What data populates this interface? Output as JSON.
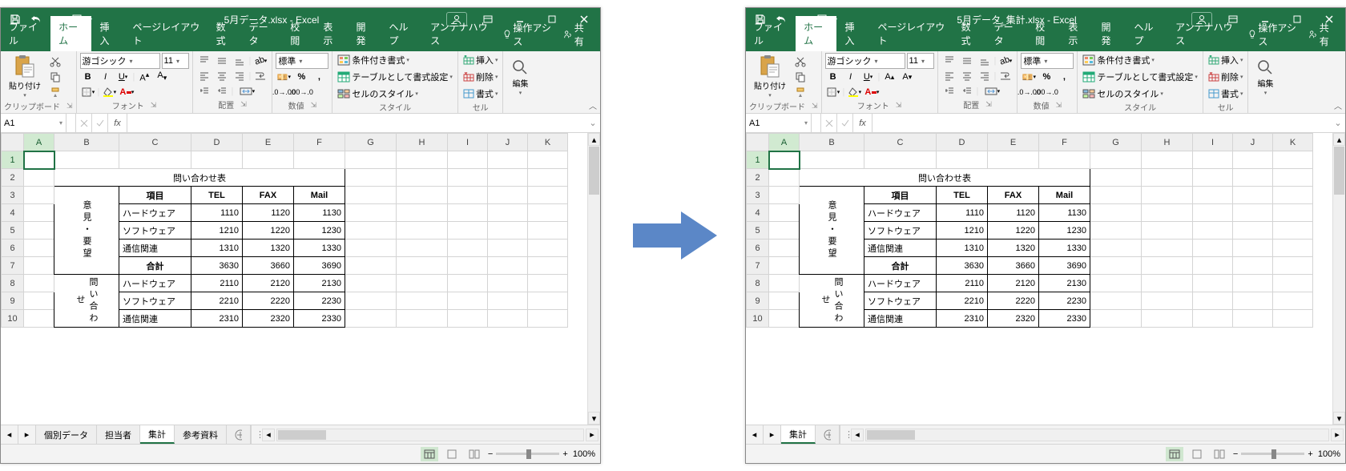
{
  "left": {
    "title": "5月データ.xlsx - Excel",
    "tabs": [
      "ファイル",
      "ホーム",
      "挿入",
      "ページレイアウト",
      "数式",
      "データ",
      "校閲",
      "表示",
      "開発",
      "ヘルプ",
      "アンテナハウス"
    ],
    "tell_me": "操作アシス",
    "share": "共有",
    "ribbon": {
      "clipboard": {
        "paste": "貼り付け",
        "label": "クリップボード"
      },
      "font": {
        "name": "游ゴシック",
        "size": "11",
        "label": "フォント"
      },
      "align": {
        "label": "配置"
      },
      "number": {
        "format": "標準",
        "label": "数値"
      },
      "styles": {
        "cond": "条件付き書式",
        "table": "テーブルとして書式設定",
        "cell": "セルのスタイル",
        "label": "スタイル"
      },
      "cells": {
        "insert": "挿入",
        "delete": "削除",
        "format": "書式",
        "label": "セル"
      },
      "editing": {
        "label": "編集"
      }
    },
    "namebox": "A1",
    "sheet_tabs": [
      "個別データ",
      "担当者",
      "集計",
      "参考資料"
    ],
    "active_sheet": "集計",
    "zoom": "100%",
    "columns": [
      "A",
      "B",
      "C",
      "D",
      "E",
      "F",
      "G",
      "H",
      "I",
      "J",
      "K"
    ],
    "rows": [
      "1",
      "2",
      "3",
      "4",
      "5",
      "6",
      "7",
      "8",
      "9",
      "10"
    ],
    "data_table": {
      "title": "問い合わせ表",
      "header": {
        "item": "項目",
        "tel": "TEL",
        "fax": "FAX",
        "mail": "Mail"
      },
      "group1": {
        "label": "意見・要望",
        "rows": [
          {
            "c": "ハードウェア",
            "d": "1110",
            "e": "1120",
            "f": "1130"
          },
          {
            "c": "ソフトウェア",
            "d": "1210",
            "e": "1220",
            "f": "1230"
          },
          {
            "c": "通信関連",
            "d": "1310",
            "e": "1320",
            "f": "1330"
          }
        ],
        "total": {
          "c": "合計",
          "d": "3630",
          "e": "3660",
          "f": "3690"
        }
      },
      "group2": {
        "label": "問い合わせ",
        "rows": [
          {
            "c": "ハードウェア",
            "d": "2110",
            "e": "2120",
            "f": "2130"
          },
          {
            "c": "ソフトウェア",
            "d": "2210",
            "e": "2220",
            "f": "2230"
          },
          {
            "c": "通信関連",
            "d": "2310",
            "e": "2320",
            "f": "2330"
          }
        ]
      }
    }
  },
  "right": {
    "title": "5月データ_集計.xlsx - Excel",
    "sheet_tabs": [
      "集計"
    ],
    "active_sheet": "集計"
  }
}
